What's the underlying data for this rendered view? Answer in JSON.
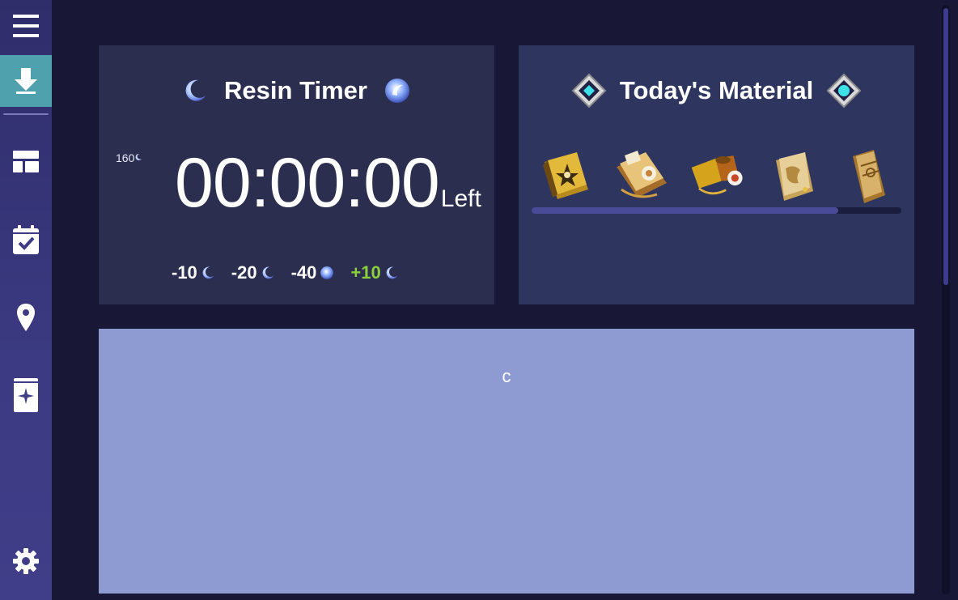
{
  "sidebar": {
    "items": [
      {
        "icon": "menu-icon"
      },
      {
        "icon": "download-icon",
        "active": true
      },
      {
        "icon": "dashboard-icon"
      },
      {
        "icon": "calendar-check-icon"
      },
      {
        "icon": "map-pin-icon"
      },
      {
        "icon": "book-icon"
      },
      {
        "icon": "gear-icon"
      }
    ]
  },
  "resin_timer": {
    "title": "Resin Timer",
    "count": "160",
    "time": "00:00:00",
    "suffix": "Left",
    "actions": [
      {
        "label": "-10",
        "icon": "fragile-resin-icon"
      },
      {
        "label": "-20",
        "icon": "fragile-resin-icon"
      },
      {
        "label": "-40",
        "icon": "condensed-resin-icon"
      },
      {
        "label": "+10",
        "icon": "fragile-resin-icon"
      }
    ]
  },
  "todays_material": {
    "title": "Today's Material",
    "items": [
      "material-book-1-icon",
      "material-book-2-icon",
      "material-weapon-icon",
      "material-slab-1-icon",
      "material-slab-2-icon"
    ],
    "scroll_progress": 0.83
  },
  "panel": {
    "text": "c"
  },
  "colors": {
    "background": "#181836",
    "sidebar": "#3b3a82",
    "active": "#4fa2ad",
    "card": "#2c2e50",
    "panel": "#8e9bd3",
    "plus": "#8ccf3a"
  }
}
